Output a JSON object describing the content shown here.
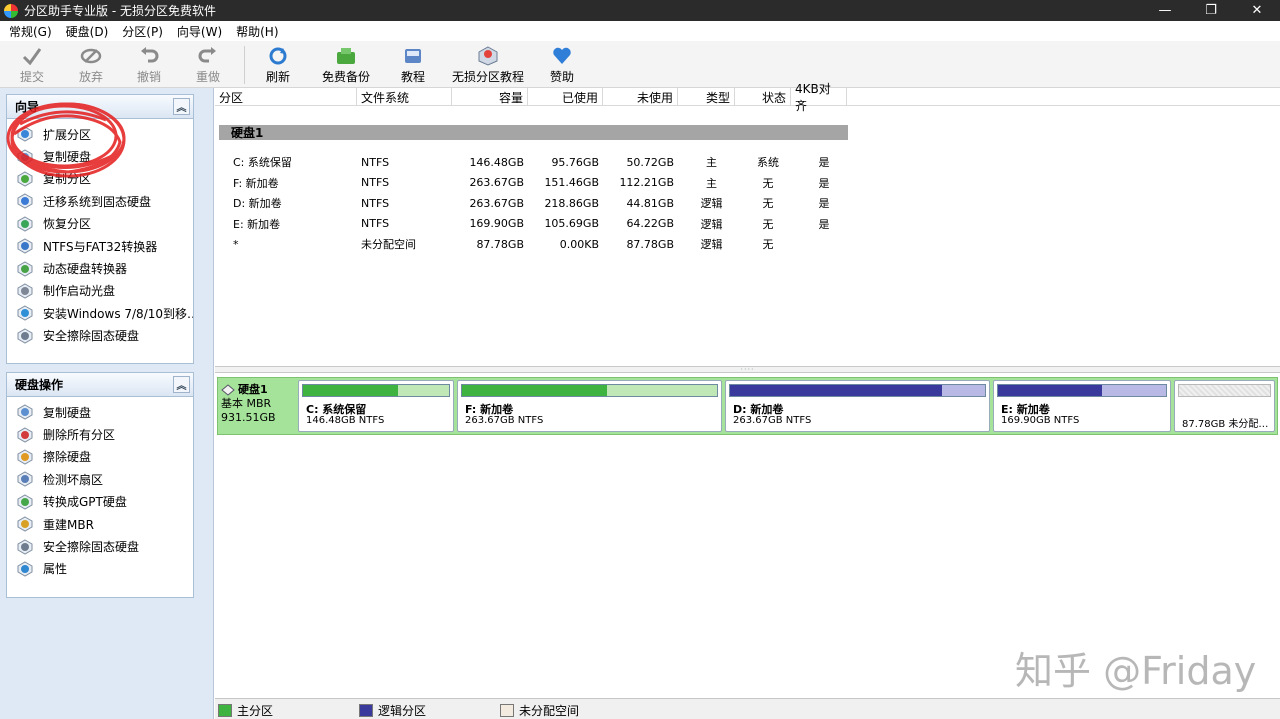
{
  "window": {
    "title": "分区助手专业版 - 无损分区免费软件",
    "buttons": {
      "minimize": "—",
      "restore": "❐",
      "close": "✕"
    }
  },
  "menu": [
    "常规(G)",
    "硬盘(D)",
    "分区(P)",
    "向导(W)",
    "帮助(H)"
  ],
  "toolbar": {
    "commit": "提交",
    "discard": "放弃",
    "undo": "撤销",
    "redo": "重做",
    "refresh": "刷新",
    "backup": "免费备份",
    "tutorial": "教程",
    "partition_tutorial": "无损分区教程",
    "donate": "赞助"
  },
  "wizard_panel": {
    "title": "向导",
    "items": [
      {
        "label": "扩展分区",
        "icon": "extend-partition-icon"
      },
      {
        "label": "复制硬盘",
        "icon": "copy-disk-icon"
      },
      {
        "label": "复制分区",
        "icon": "copy-partition-icon"
      },
      {
        "label": "迁移系统到固态硬盘",
        "icon": "migrate-os-icon"
      },
      {
        "label": "恢复分区",
        "icon": "recover-partition-icon"
      },
      {
        "label": "NTFS与FAT32转换器",
        "icon": "convert-fs-icon"
      },
      {
        "label": "动态硬盘转换器",
        "icon": "dynamic-disk-icon"
      },
      {
        "label": "制作启动光盘",
        "icon": "bootable-cd-icon"
      },
      {
        "label": "安装Windows 7/8/10到移…",
        "icon": "windows-to-go-icon"
      },
      {
        "label": "安全擦除固态硬盘",
        "icon": "ssd-erase-icon"
      }
    ]
  },
  "disk_ops_panel": {
    "title": "硬盘操作",
    "items": [
      {
        "label": "复制硬盘",
        "icon": "copy-disk-icon"
      },
      {
        "label": "删除所有分区",
        "icon": "delete-partitions-icon"
      },
      {
        "label": "擦除硬盘",
        "icon": "wipe-disk-icon"
      },
      {
        "label": "检测坏扇区",
        "icon": "bad-sector-icon"
      },
      {
        "label": "转换成GPT硬盘",
        "icon": "convert-gpt-icon"
      },
      {
        "label": "重建MBR",
        "icon": "rebuild-mbr-icon"
      },
      {
        "label": "安全擦除固态硬盘",
        "icon": "ssd-erase-icon"
      },
      {
        "label": "属性",
        "icon": "properties-icon"
      }
    ]
  },
  "table": {
    "columns": [
      "分区",
      "文件系统",
      "容量",
      "已使用",
      "未使用",
      "类型",
      "状态",
      "4KB对齐"
    ],
    "disk_label": "硬盘1",
    "rows": [
      [
        "C: 系统保留",
        "NTFS",
        "146.48GB",
        "95.76GB",
        "50.72GB",
        "主",
        "系统",
        "是"
      ],
      [
        "F: 新加卷",
        "NTFS",
        "263.67GB",
        "151.46GB",
        "112.21GB",
        "主",
        "无",
        "是"
      ],
      [
        "D: 新加卷",
        "NTFS",
        "263.67GB",
        "218.86GB",
        "44.81GB",
        "逻辑",
        "无",
        "是"
      ],
      [
        "E: 新加卷",
        "NTFS",
        "169.90GB",
        "105.69GB",
        "64.22GB",
        "逻辑",
        "无",
        "是"
      ],
      [
        "*",
        "未分配空间",
        "87.78GB",
        "0.00KB",
        "87.78GB",
        "逻辑",
        "无",
        ""
      ]
    ]
  },
  "disk_map": {
    "disk_name": "硬盘1",
    "disk_type": "基本 MBR",
    "disk_size": "931.51GB",
    "partitions": [
      {
        "name": "C: 系统保留",
        "info": "146.48GB NTFS",
        "used_fraction": 0.65,
        "color": "#3fb33f",
        "kind": "primary"
      },
      {
        "name": "F: 新加卷",
        "info": "263.67GB NTFS",
        "used_fraction": 0.57,
        "color": "#3fb33f",
        "kind": "primary"
      },
      {
        "name": "D: 新加卷",
        "info": "263.67GB NTFS",
        "used_fraction": 0.83,
        "color": "#3a3a9c",
        "kind": "logical"
      },
      {
        "name": "E: 新加卷",
        "info": "169.90GB NTFS",
        "used_fraction": 0.62,
        "color": "#3a3a9c",
        "kind": "logical"
      },
      {
        "name": "",
        "info": "87.78GB 未分配…",
        "used_fraction": 0,
        "color": "#e8e8e8",
        "kind": "unallocated"
      }
    ]
  },
  "legend": {
    "primary": "主分区",
    "logical": "逻辑分区",
    "unallocated": "未分配空间",
    "primary_color": "#3fb33f",
    "logical_color": "#3a3a9c",
    "unallocated_color": "#f4ebe0"
  },
  "watermark": "知乎 @Friday"
}
